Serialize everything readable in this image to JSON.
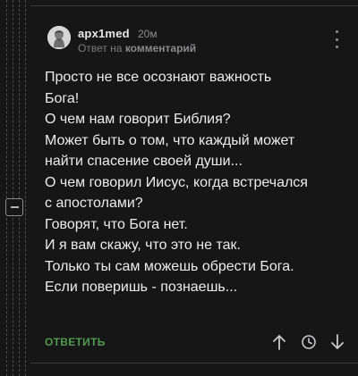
{
  "comment": {
    "author": "apx1med",
    "time": "20м",
    "reply_prefix": "Ответ на",
    "reply_target": "комментарий",
    "body_lines": [
      "Просто не все осознают важность",
      "Бога!",
      "О чем нам говорит Библия?",
      "Может быть о том, что каждый может",
      "найти спасение своей души...",
      "О чем говорил Иисус, когда встречался",
      "с апостолами?",
      "Говорят, что Бога нет.",
      "И я вам скажу, что это не так.",
      "Только ты сам можешь обрести Бога.",
      "Если поверишь - познаешь..."
    ]
  },
  "actions": {
    "reply_label": "ОТВЕТИТЬ",
    "upvote_icon": "arrow-up-icon",
    "save_icon": "clock-icon",
    "downvote_icon": "arrow-down-icon",
    "more_icon": "kebab-menu-icon",
    "collapse_icon": "minus-icon"
  },
  "colors": {
    "background": "#161617",
    "text": "#ececec",
    "muted": "#8c8c8e",
    "accent_green": "#4f9b4f"
  }
}
